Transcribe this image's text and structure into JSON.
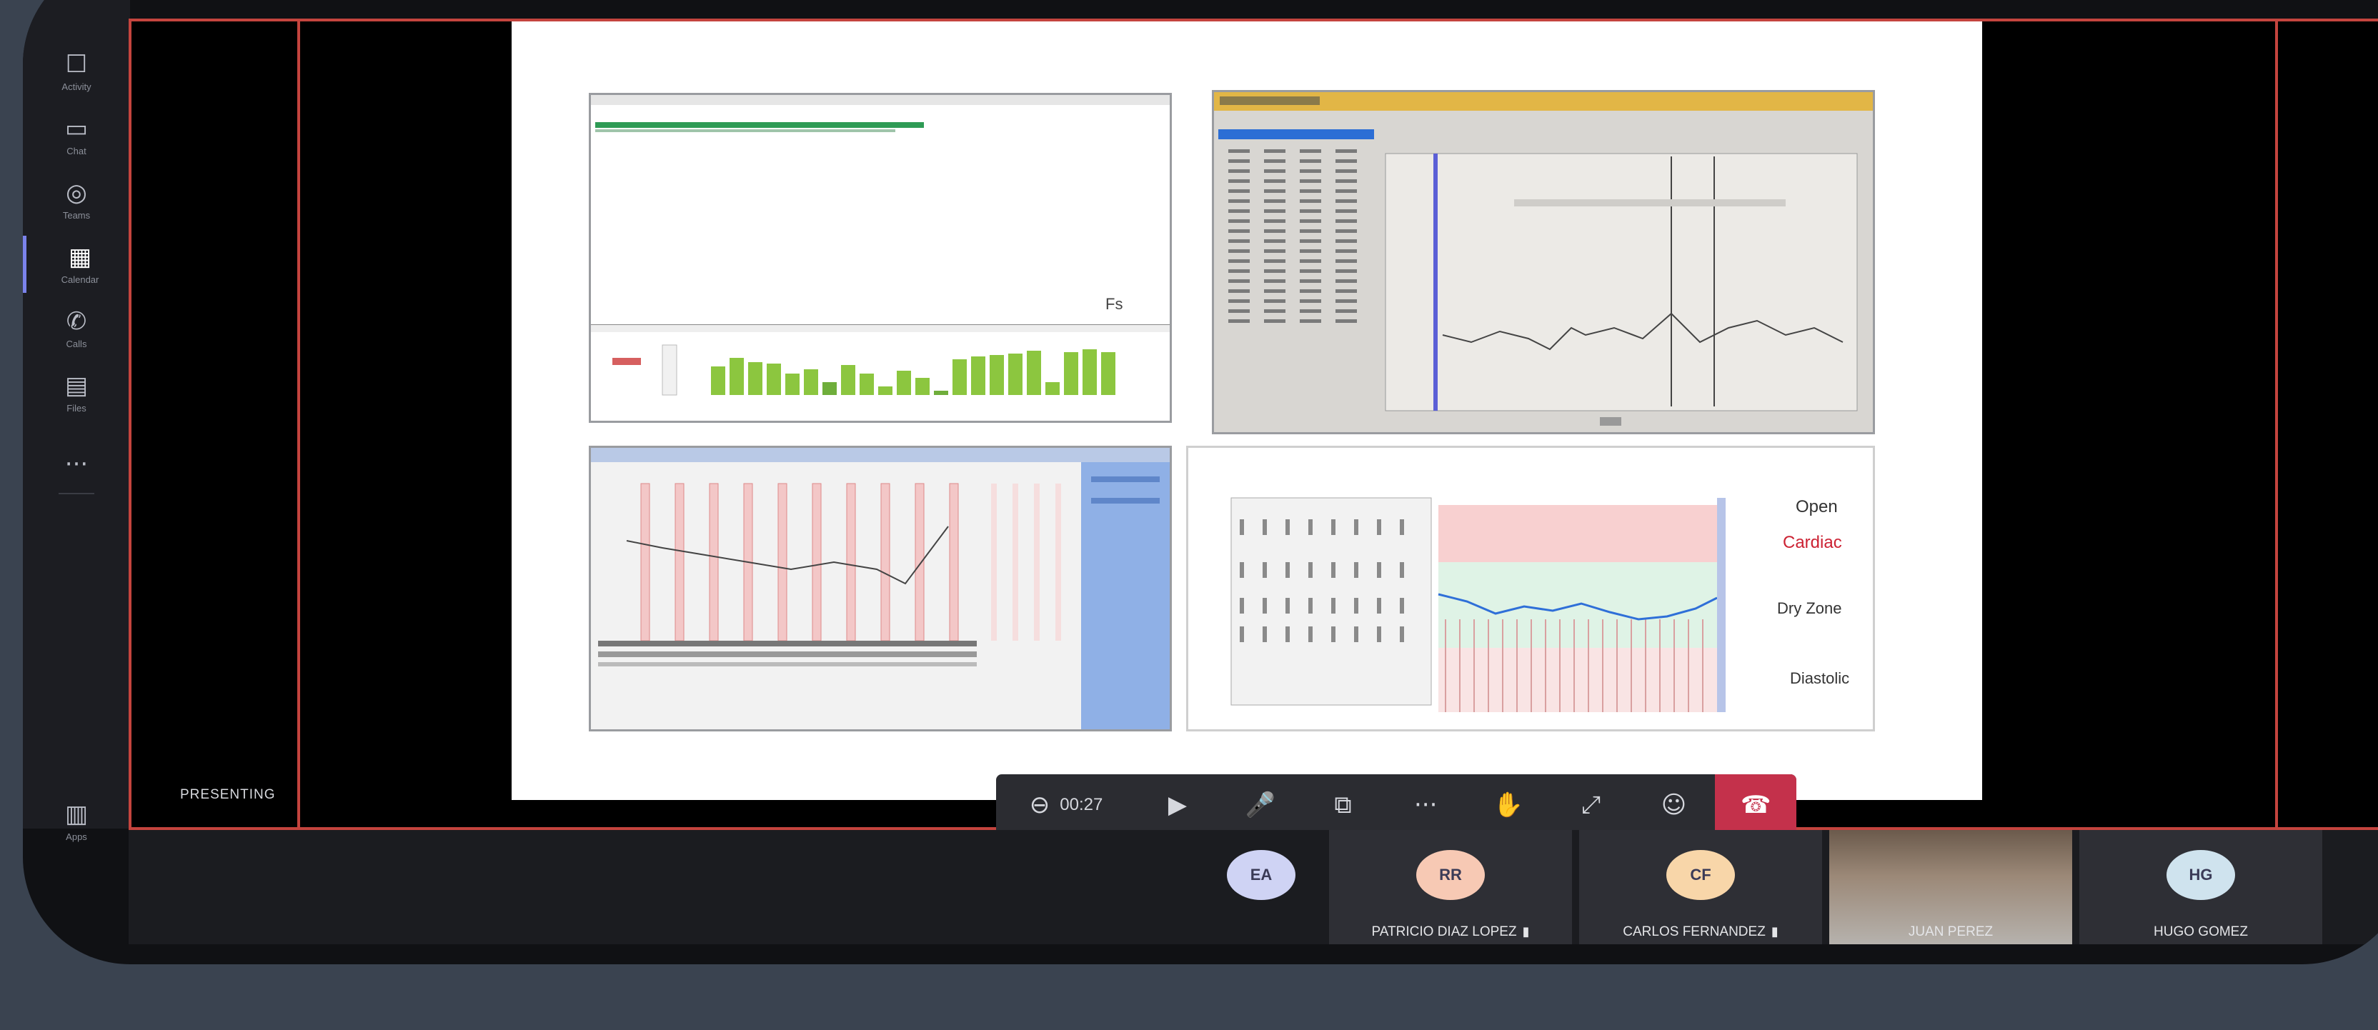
{
  "rail": {
    "items": [
      {
        "icon": "activity-icon",
        "glyph": "☐",
        "label": "Activity"
      },
      {
        "icon": "chat-icon",
        "glyph": "▭",
        "label": "Chat"
      },
      {
        "icon": "teams-icon",
        "glyph": "◎",
        "label": "Teams"
      },
      {
        "icon": "calendar-icon",
        "glyph": "▦",
        "label": "Calendar"
      },
      {
        "icon": "calls-icon",
        "glyph": "✆",
        "label": "Calls"
      },
      {
        "icon": "files-icon",
        "glyph": "▤",
        "label": "Files"
      },
      {
        "icon": "more-apps-icon",
        "glyph": "···",
        "label": ""
      }
    ],
    "bottom": {
      "icon": "apps-icon",
      "glyph": "▥",
      "label": "Apps"
    }
  },
  "stage": {
    "presenter_name": "PRESENTING"
  },
  "slide": {
    "panel_d_labels": {
      "top": "Open",
      "red": "Cardiac",
      "mid": "Dry Zone",
      "bottom": "Diastolic"
    }
  },
  "toolbar": {
    "timer": "00:27",
    "buttons": [
      {
        "name": "camera-button",
        "icon": "camera-icon",
        "glyph": "▶"
      },
      {
        "name": "microphone-button",
        "icon": "microphone-icon",
        "glyph": "🎤"
      },
      {
        "name": "share-button",
        "icon": "share-tray-icon",
        "glyph": "⧉"
      },
      {
        "name": "more-actions-button",
        "icon": "more-icon",
        "glyph": "···"
      },
      {
        "name": "raise-hand-button",
        "icon": "hand-icon",
        "glyph": "✋"
      },
      {
        "name": "view-button",
        "icon": "fullscreen-icon",
        "glyph": "⤢"
      },
      {
        "name": "reactions-button",
        "icon": "reactions-icon",
        "glyph": "☺"
      }
    ],
    "hangup_glyph": "☎"
  },
  "participants": [
    {
      "initials": "EA",
      "name": "",
      "color": "#cfd3f4"
    },
    {
      "initials": "RR",
      "name": "PATRICIO DIAZ LOPEZ",
      "color": "#f7c9b4"
    },
    {
      "initials": "CF",
      "name": "CARLOS FERNANDEZ",
      "color": "#f8d6a9"
    },
    {
      "initials": "",
      "name": "JUAN PEREZ",
      "color": ""
    },
    {
      "initials": "HG",
      "name": "HUGO GOMEZ",
      "color": "#cfe3ee"
    }
  ],
  "colors": {
    "accent": "#7b83eb",
    "hangup": "#c4314b",
    "stage_border": "#c4443e"
  }
}
